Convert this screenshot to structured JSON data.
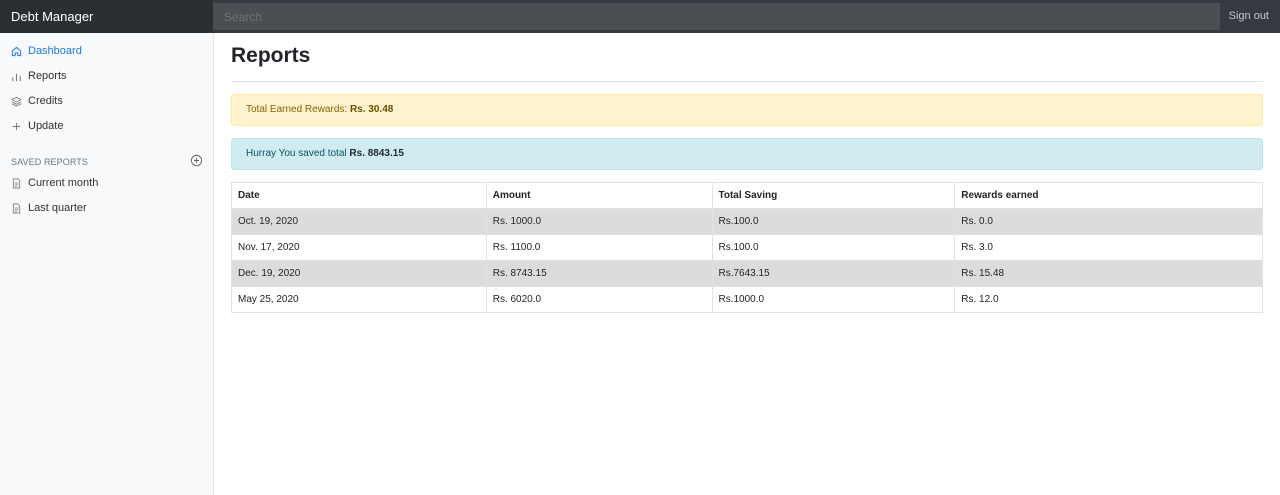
{
  "navbar": {
    "brand": "Debt Manager",
    "search_placeholder": "Search",
    "signout_label": "Sign out"
  },
  "sidebar": {
    "items": [
      {
        "label": "Dashboard",
        "icon": "home-icon",
        "active": true
      },
      {
        "label": "Reports",
        "icon": "bar-chart-icon",
        "active": false
      },
      {
        "label": "Credits",
        "icon": "layers-icon",
        "active": false
      },
      {
        "label": "Update",
        "icon": "plus-icon",
        "active": false
      }
    ],
    "saved_heading": "SAVED REPORTS",
    "saved_items": [
      {
        "label": "Current month",
        "icon": "file-text-icon"
      },
      {
        "label": "Last quarter",
        "icon": "file-text-icon"
      }
    ]
  },
  "main": {
    "title": "Reports",
    "rewards_alert": {
      "text": "Total Earned Rewards: ",
      "value": "Rs. 30.48"
    },
    "savings_alert": {
      "text": "Hurray You saved total ",
      "value": "Rs. 8843.15"
    },
    "table": {
      "headers": [
        "Date",
        "Amount",
        "Total Saving",
        "Rewards earned"
      ],
      "rows": [
        [
          "Oct. 19, 2020",
          "Rs. 1000.0",
          "Rs.100.0",
          "Rs. 0.0"
        ],
        [
          "Nov. 17, 2020",
          "Rs. 1100.0",
          "Rs.100.0",
          "Rs. 3.0"
        ],
        [
          "Dec. 19, 2020",
          "Rs. 8743.15",
          "Rs.7643.15",
          "Rs. 15.48"
        ],
        [
          "May 25, 2020",
          "Rs. 6020.0",
          "Rs.1000.0",
          "Rs. 12.0"
        ]
      ]
    }
  },
  "colors": {
    "navbar": "#343a40",
    "active_link": "#1f7ae0",
    "warning_bg": "#fff3cd",
    "info_bg": "#d1ecf1"
  }
}
